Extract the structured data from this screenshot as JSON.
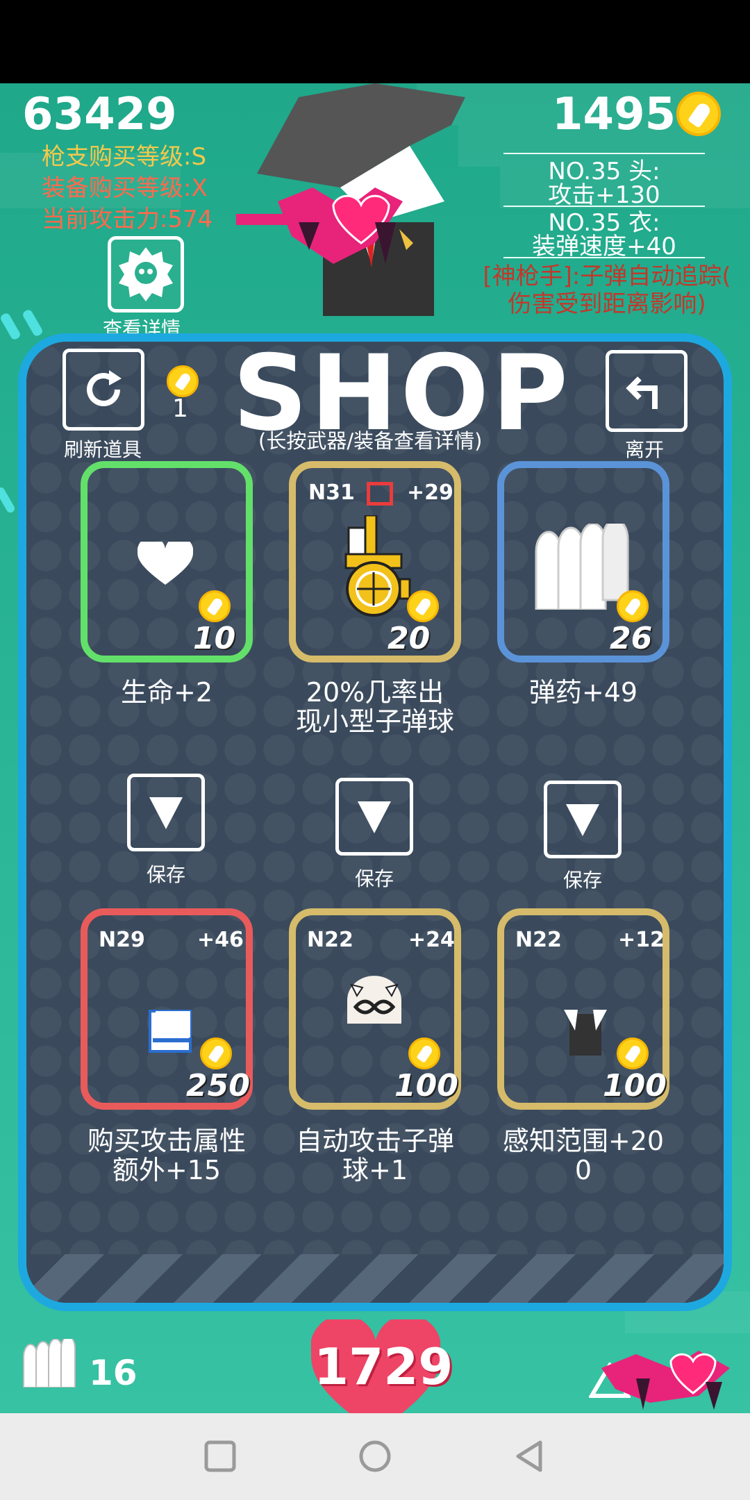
{
  "hud": {
    "score": "63429",
    "gun_level": "枪支购买等级:S",
    "equip_level": "装备购买等级:X",
    "attack_power": "当前攻击力:574",
    "detail_label": "查看详情",
    "coins": "1495",
    "equip_head_title": "NO.35 头:",
    "equip_head_bonus": "攻击+130",
    "equip_body_title": "NO.35 衣:",
    "equip_body_bonus": "装弹速度+40",
    "skill_line1": "[神枪手]:子弹自动追踪(",
    "skill_line2": "伤害受到距离影响)"
  },
  "shop": {
    "title": "SHOP",
    "subtitle": "(长按武器/装备查看详情)",
    "refresh_label": "刷新道具",
    "refresh_cost": "1",
    "leave_label": "离开",
    "save_label": "保存",
    "items": [
      {
        "tag_left": "",
        "tag_right": "",
        "price": "10",
        "desc_1": "生命+2",
        "desc_2": "",
        "border": "#63e06a",
        "icon": "heart-icon"
      },
      {
        "tag_left": "N31",
        "tag_right": "+29",
        "price": "20",
        "desc_1": "20%几率出",
        "desc_2": "现小型子弹球",
        "border": "#d6bb6a",
        "icon": "gold-gun-icon"
      },
      {
        "tag_left": "",
        "tag_right": "",
        "price": "26",
        "desc_1": "弹药+49",
        "desc_2": "",
        "border": "#5b93d8",
        "icon": "bullets-icon"
      },
      {
        "tag_left": "N29",
        "tag_right": "+46",
        "price": "250",
        "desc_1": "购买攻击属性",
        "desc_2": "额外+15",
        "border": "#e95b5b",
        "icon": "block-gear-icon"
      },
      {
        "tag_left": "N22",
        "tag_right": "+24",
        "price": "100",
        "desc_1": "自动攻击子弹",
        "desc_2": "球+1",
        "border": "#d6bb6a",
        "icon": "mask-head-icon"
      },
      {
        "tag_left": "N22",
        "tag_right": "+12",
        "price": "100",
        "desc_1": "感知范围+20",
        "desc_2": "0",
        "border": "#d6bb6a",
        "icon": "black-coat-icon"
      }
    ]
  },
  "bottom": {
    "ammo": "16",
    "hp": "1729"
  },
  "colors": {
    "panel_border": "#1ea8e0",
    "panel_bg": "#3a4a5c",
    "coin": "#ffd21a",
    "heart": "#ee4466"
  }
}
